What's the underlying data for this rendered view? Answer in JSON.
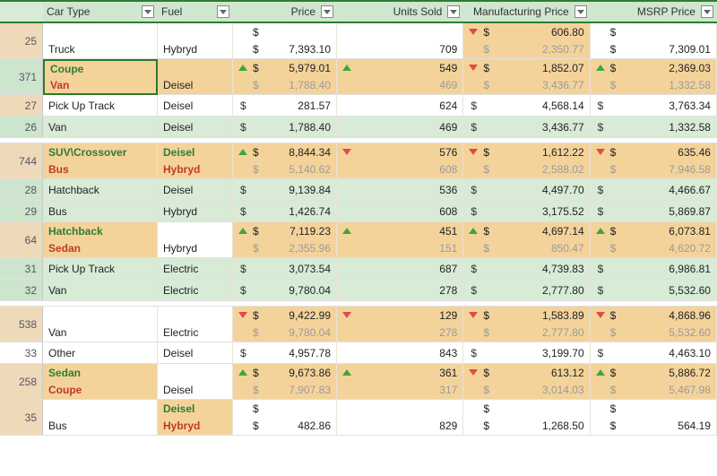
{
  "headers": {
    "carType": "Car Type",
    "fuel": "Fuel",
    "price": "Price",
    "units": "Units Sold",
    "mfg": "Manufacturing Price",
    "msrp": "MSRP Price"
  },
  "rows": [
    {
      "kind": "diff",
      "rn": "25",
      "bg": "W",
      "rnbg": "R",
      "carOld": "",
      "carNew": "Truck",
      "fuelOld": "",
      "fuelNew": "Hybryd",
      "priceOld": "",
      "priceNew": "7,393.10",
      "pDir": "",
      "unitsOld": "",
      "unitsNew": "709",
      "uDir": "",
      "mfgOld": "606.80",
      "mfgNew": "2,350.77",
      "mDir": "dn",
      "msrpOld": "",
      "msrpNew": "7,309.01",
      "sDir": "",
      "mfgCellBg": "O"
    },
    {
      "kind": "diff",
      "rn": "371",
      "bg": "O",
      "sel": true,
      "rnbg": "Gh",
      "carOld": "Coupe",
      "carNew": "Van",
      "fuelOld": "",
      "fuelNew": "Deisel",
      "priceOld": "5,979.01",
      "priceNew": "1,788.40",
      "pDir": "up",
      "unitsOld": "549",
      "unitsNew": "469",
      "uDir": "up",
      "mfgOld": "1,852.07",
      "mfgNew": "3,436.77",
      "mDir": "dn",
      "msrpOld": "2,369.03",
      "msrpNew": "1,332.58",
      "sDir": "up"
    },
    {
      "kind": "single",
      "rn": "27",
      "bg": "W",
      "rnbg": "R",
      "car": "Pick Up Track",
      "fuel": "Deisel",
      "price": "281.57",
      "units": "624",
      "mfg": "4,568.14",
      "msrp": "3,763.34"
    },
    {
      "kind": "single",
      "rn": "26",
      "bg": "G",
      "rnbg": "Gh",
      "car": "Van",
      "fuel": "Deisel",
      "price": "1,788.40",
      "units": "469",
      "mfg": "3,436.77",
      "msrp": "1,332.58"
    },
    {
      "kind": "gap"
    },
    {
      "kind": "diff",
      "rn": "744",
      "bg": "O",
      "rnbg": "R",
      "carOld": "SUV\\Crossover",
      "carNew": "Bus",
      "fuelOld": "Deisel",
      "fuelNew": "Hybryd",
      "priceOld": "8,844.34",
      "priceNew": "5,140.62",
      "pDir": "up",
      "unitsOld": "576",
      "unitsNew": "608",
      "uDir": "dn",
      "mfgOld": "1,612.22",
      "mfgNew": "2,588.02",
      "mDir": "dn",
      "msrpOld": "635.46",
      "msrpNew": "7,946.58",
      "sDir": "dn"
    },
    {
      "kind": "single",
      "rn": "28",
      "bg": "G",
      "rnbg": "Gh",
      "car": "Hatchback",
      "fuel": "Deisel",
      "price": "9,139.84",
      "units": "536",
      "mfg": "4,497.70",
      "msrp": "4,466.67"
    },
    {
      "kind": "single",
      "rn": "29",
      "bg": "G",
      "rnbg": "Gh",
      "car": "Bus",
      "fuel": "Hybryd",
      "price": "1,426.74",
      "units": "608",
      "mfg": "3,175.52",
      "msrp": "5,869.87"
    },
    {
      "kind": "diff",
      "rn": "64",
      "bg": "O",
      "rnbg": "R",
      "carOld": "Hatchback",
      "carNew": "Sedan",
      "fuelOld": "",
      "fuelNew": "Hybryd",
      "fuelBg": "W",
      "priceOld": "7,119.23",
      "priceNew": "2,355.96",
      "pDir": "up",
      "unitsOld": "451",
      "unitsNew": "151",
      "uDir": "up",
      "mfgOld": "4,697.14",
      "mfgNew": "850.47",
      "mDir": "up",
      "msrpOld": "6,073.81",
      "msrpNew": "4,620.72",
      "sDir": "up"
    },
    {
      "kind": "single",
      "rn": "31",
      "bg": "G",
      "rnbg": "Gh",
      "car": "Pick Up Track",
      "fuel": "Electric",
      "price": "3,073.54",
      "units": "687",
      "mfg": "4,739.83",
      "msrp": "6,986.81"
    },
    {
      "kind": "single",
      "rn": "32",
      "bg": "G",
      "rnbg": "Gh",
      "car": "Van",
      "fuel": "Electric",
      "price": "9,780.04",
      "units": "278",
      "mfg": "2,777.80",
      "msrp": "5,532.60"
    },
    {
      "kind": "gap"
    },
    {
      "kind": "diff",
      "rn": "538",
      "bg": "O",
      "rnbg": "R",
      "carOld": "",
      "carNew": "Van",
      "carBg": "W",
      "fuelOld": "",
      "fuelNew": "Electric",
      "fuelBg": "W",
      "priceOld": "9,422.99",
      "priceNew": "9,780.04",
      "pDir": "dn",
      "unitsOld": "129",
      "unitsNew": "278",
      "uDir": "dn",
      "mfgOld": "1,583.89",
      "mfgNew": "2,777.80",
      "mDir": "dn",
      "msrpOld": "4,868.96",
      "msrpNew": "5,532.60",
      "sDir": "dn"
    },
    {
      "kind": "single",
      "rn": "33",
      "bg": "W",
      "rnbg": "W",
      "car": "Other",
      "fuel": "Deisel",
      "price": "4,957.78",
      "units": "843",
      "mfg": "3,199.70",
      "msrp": "4,463.10"
    },
    {
      "kind": "diff",
      "rn": "258",
      "bg": "O",
      "rnbg": "R",
      "carOld": "Sedan",
      "carNew": "Coupe",
      "fuelOld": "",
      "fuelNew": "Deisel",
      "fuelBg": "W",
      "priceOld": "9,673.86",
      "priceNew": "7,907.83",
      "pDir": "up",
      "unitsOld": "361",
      "unitsNew": "317",
      "uDir": "up",
      "mfgOld": "613.12",
      "mfgNew": "3,014.03",
      "mDir": "dn",
      "msrpOld": "5,886.72",
      "msrpNew": "5,467.98",
      "sDir": "up"
    },
    {
      "kind": "diff",
      "rn": "35",
      "bg": "W",
      "rnbg": "R",
      "carOld": "",
      "carNew": "Bus",
      "fuelOld": "Deisel",
      "fuelNew": "Hybryd",
      "fuelBg": "O",
      "priceOld": "",
      "priceNew": "482.86",
      "pDir": "",
      "unitsOld": "",
      "unitsNew": "829",
      "uDir": "",
      "mfgOld": "",
      "mfgNew": "1,268.50",
      "mDir": "",
      "msrpOld": "",
      "msrpNew": "564.19",
      "sDir": ""
    }
  ]
}
